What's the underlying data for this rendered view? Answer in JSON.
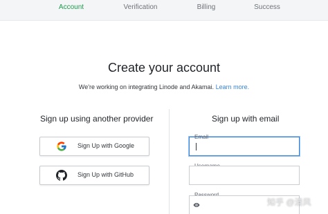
{
  "steps": [
    {
      "label": "Account",
      "active": true
    },
    {
      "label": "Verification",
      "active": false
    },
    {
      "label": "Billing",
      "active": false
    },
    {
      "label": "Success",
      "active": false
    }
  ],
  "page": {
    "title": "Create your account",
    "subtitle_text": "We're working on integrating Linode and Akamai.",
    "subtitle_link": "Learn more."
  },
  "providers": {
    "heading": "Sign up using another provider",
    "google_label": "Sign Up with Google",
    "github_label": "Sign Up with GitHub"
  },
  "email_signup": {
    "heading": "Sign up with email",
    "email_label": "Email",
    "email_value": "",
    "username_label": "Username",
    "username_value": "",
    "password_label": "Password",
    "password_value": ""
  },
  "watermark": "知乎 @清风",
  "colors": {
    "active_step": "#1d9c4e",
    "link": "#3683dc",
    "focus_border": "#3683dc"
  }
}
